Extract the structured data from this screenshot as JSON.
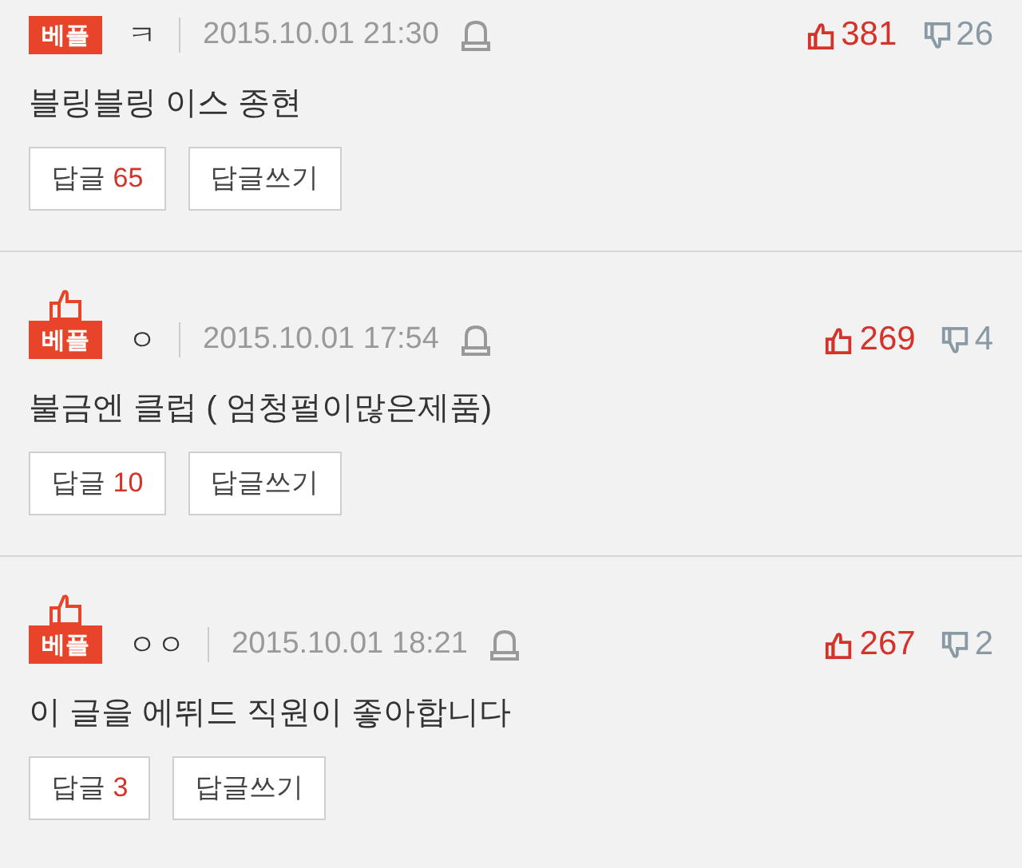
{
  "comments": [
    {
      "badge": "베플",
      "best_icon": false,
      "author": "ㅋ",
      "date": "2015.10.01 21:30",
      "likes": "381",
      "dislikes": "26",
      "text": "블링블링 이스 종현",
      "reply_label": "답글",
      "reply_count": "65",
      "write_label": "답글쓰기"
    },
    {
      "badge": "베플",
      "best_icon": true,
      "author": "ㅇ",
      "date": "2015.10.01 17:54",
      "likes": "269",
      "dislikes": "4",
      "text": "불금엔 클럽 ( 엄청펄이많은제품)",
      "reply_label": "답글",
      "reply_count": "10",
      "write_label": "답글쓰기"
    },
    {
      "badge": "베플",
      "best_icon": true,
      "author": "ㅇㅇ",
      "date": "2015.10.01 18:21",
      "likes": "267",
      "dislikes": "2",
      "text": "이 글을 에뛰드 직원이 좋아합니다",
      "reply_label": "답글",
      "reply_count": "3",
      "write_label": "답글쓰기"
    }
  ]
}
